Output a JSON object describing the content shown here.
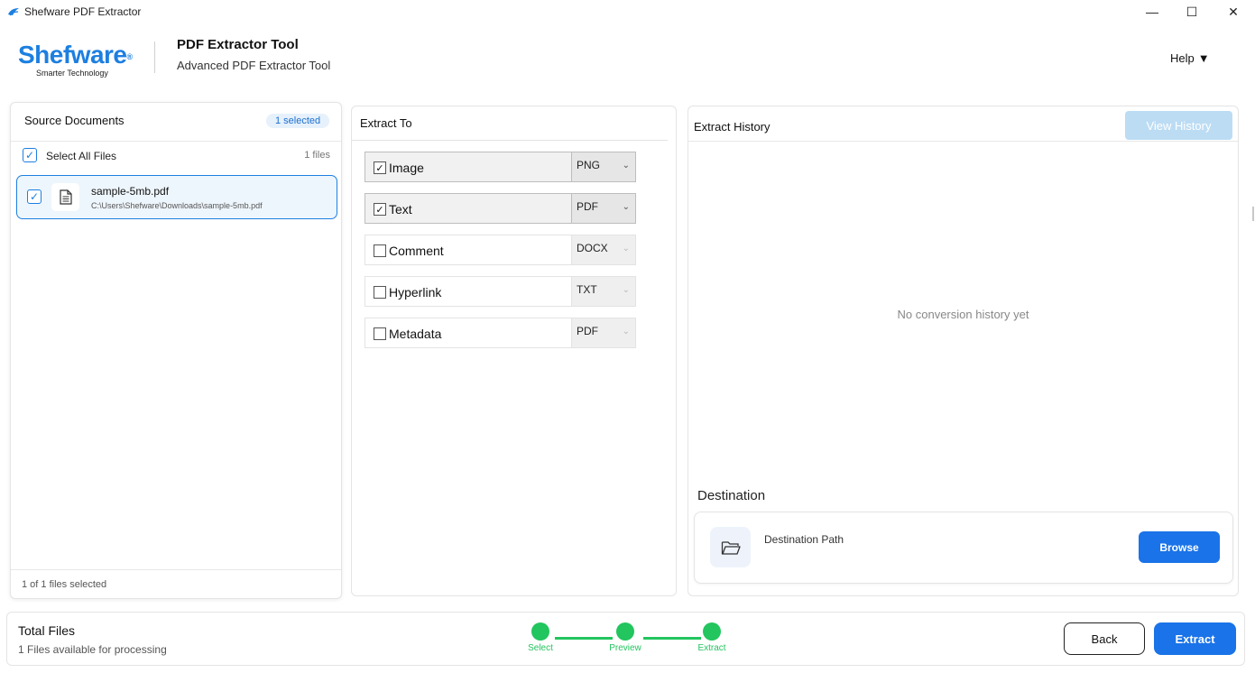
{
  "window": {
    "title": "Shefware PDF Extractor",
    "min_glyph": "—",
    "max_glyph": "☐",
    "close_glyph": "✕"
  },
  "header": {
    "brand": "Shefware",
    "brand_mark": "®",
    "tagline": "Smarter Technology",
    "tool_title": "PDF Extractor Tool",
    "tool_subtitle": "Advanced PDF Extractor Tool",
    "help_label": "Help",
    "help_caret": "▼"
  },
  "source": {
    "title": "Source Documents",
    "selected_badge": "1 selected",
    "select_all_label": "Select All Files",
    "file_count": "1 files",
    "files": [
      {
        "name": "sample-5mb.pdf",
        "path": "C:\\Users\\Shefware\\Downloads\\sample-5mb.pdf",
        "checked": true
      }
    ],
    "footer": "1 of 1 files selected",
    "check_glyph": "✓"
  },
  "extract": {
    "title": "Extract To",
    "options": [
      {
        "label": "Image",
        "format": "PNG",
        "checked": true
      },
      {
        "label": "Text",
        "format": "PDF",
        "checked": true
      },
      {
        "label": "Comment",
        "format": "DOCX",
        "checked": false
      },
      {
        "label": "Hyperlink",
        "format": "TXT",
        "checked": false
      },
      {
        "label": "Metadata",
        "format": "PDF",
        "checked": false
      }
    ],
    "check_glyph": "✓",
    "caret_glyph": "⌄"
  },
  "history": {
    "title": "Extract History",
    "view_button": "View History",
    "empty_text": "No conversion history yet"
  },
  "destination": {
    "title": "Destination",
    "path_label": "Destination Path",
    "browse_button": "Browse"
  },
  "footer": {
    "total_title": "Total Files",
    "total_sub": "1 Files available for processing",
    "steps": [
      "Select",
      "Preview",
      "Extract"
    ],
    "back_button": "Back",
    "extract_button": "Extract"
  },
  "colors": {
    "accent": "#1a73e8",
    "brand": "#1d7fe0",
    "step_done": "#22c55e",
    "view_history_disabled": "#bcdcf4"
  }
}
